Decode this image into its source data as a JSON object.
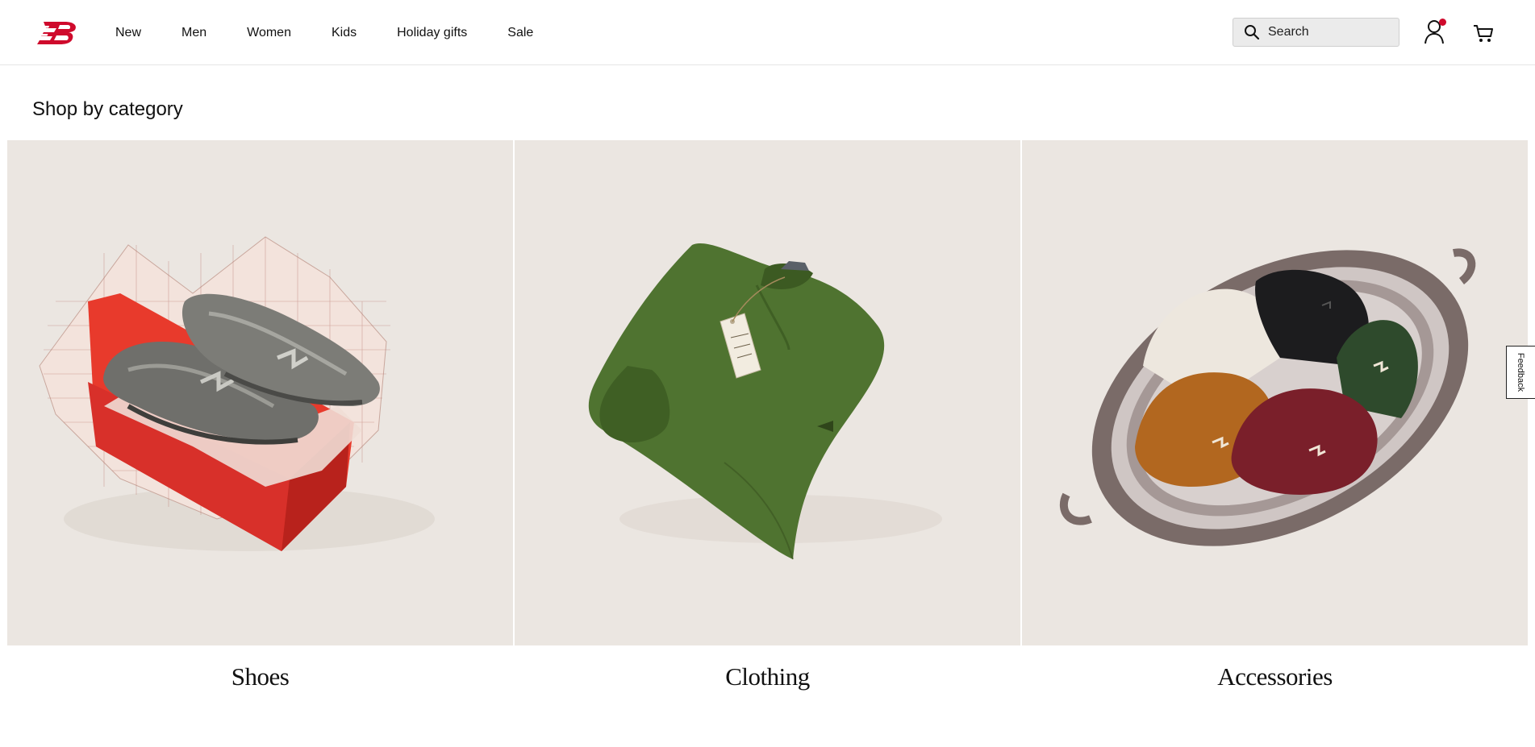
{
  "header": {
    "logo_alt": "New Balance",
    "nav": [
      {
        "label": "New"
      },
      {
        "label": "Men"
      },
      {
        "label": "Women"
      },
      {
        "label": "Kids"
      },
      {
        "label": "Holiday gifts"
      },
      {
        "label": "Sale"
      }
    ],
    "search": {
      "label": "Search",
      "icon": "search-icon"
    },
    "account": {
      "icon": "user-icon",
      "notification_color": "#cf0a2c"
    },
    "cart": {
      "icon": "cart-icon"
    }
  },
  "main": {
    "section_title": "Shop by category",
    "categories": [
      {
        "label": "Shoes",
        "image": "shoes-in-red-box"
      },
      {
        "label": "Clothing",
        "image": "green-sweatshirt"
      },
      {
        "label": "Accessories",
        "image": "beanies-on-silver-tray"
      }
    ]
  },
  "feedback": {
    "label": "Feedback"
  },
  "colors": {
    "brand": "#cf0a2c",
    "tile_background": "#ebe6e1"
  }
}
